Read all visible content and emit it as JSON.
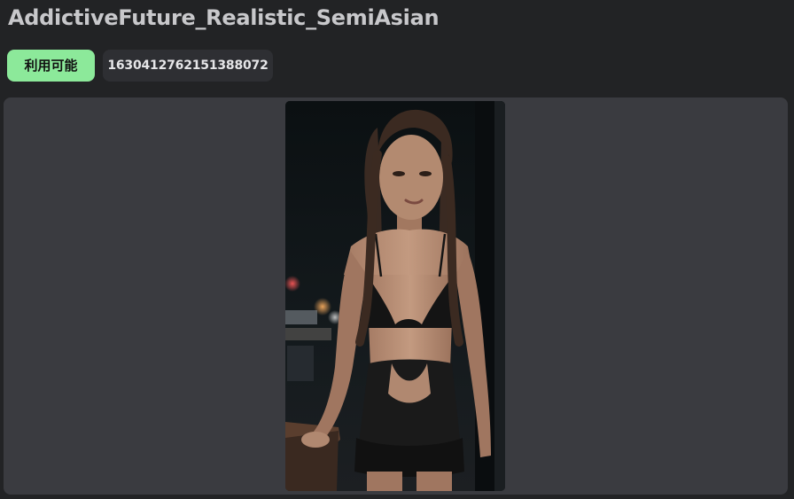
{
  "header": {
    "title": "AddictiveFuture_Realistic_SemiAsian"
  },
  "badges": {
    "status_label": "利用可能",
    "id_label": "1630412762151388072"
  },
  "preview": {
    "image_description_icon": "photo-image"
  },
  "colors": {
    "background": "#222325",
    "panel": "#3a3b40",
    "status_badge": "#8ce99a",
    "id_badge": "#2e2f33",
    "title_text": "#c8c8cb"
  }
}
